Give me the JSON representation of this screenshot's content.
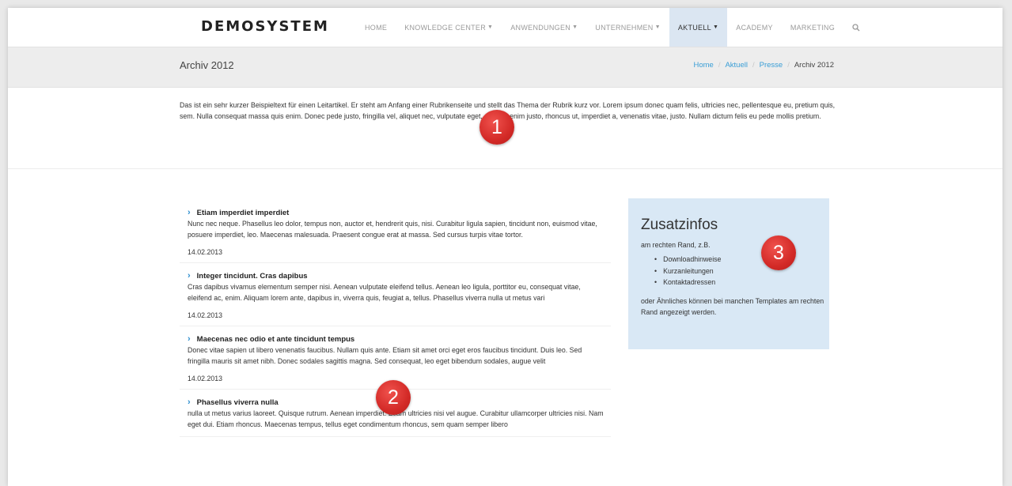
{
  "header": {
    "logo": "DEMOSYSTEM",
    "nav": [
      {
        "label": "HOME",
        "dropdown": false,
        "active": false
      },
      {
        "label": "KNOWLEDGE CENTER",
        "dropdown": true,
        "active": false
      },
      {
        "label": "ANWENDUNGEN",
        "dropdown": true,
        "active": false
      },
      {
        "label": "UNTERNEHMEN",
        "dropdown": true,
        "active": false
      },
      {
        "label": "AKTUELL",
        "dropdown": true,
        "active": true
      },
      {
        "label": "ACADEMY",
        "dropdown": false,
        "active": false
      },
      {
        "label": "MARKETING",
        "dropdown": false,
        "active": false
      }
    ],
    "search_icon": "search-icon"
  },
  "band": {
    "title": "Archiv 2012",
    "breadcrumb": [
      "Home",
      "Aktuell",
      "Presse",
      "Archiv 2012"
    ]
  },
  "intro": {
    "text": "Das ist ein sehr kurzer Beispieltext für einen Leitartikel. Er steht am Anfang einer Rubrikenseite und stellt das Thema der Rubrik kurz vor. Lorem ipsum donec quam felis, ultricies nec, pellentesque eu, pretium quis, sem. Nulla consequat massa quis enim. Donec pede justo, fringilla vel, aliquet nec, vulputate eget, arcu. In enim justo, rhoncus ut, imperdiet a, venenatis vitae, justo. Nullam dictum felis eu pede mollis pretium."
  },
  "articles": [
    {
      "title": "Etiam imperdiet imperdiet",
      "text": "Nunc nec neque. Phasellus leo dolor, tempus non, auctor et, hendrerit quis, nisi. Curabitur ligula sapien, tincidunt non, euismod vitae, posuere imperdiet, leo. Maecenas malesuada. Praesent congue erat at massa. Sed cursus turpis vitae tortor.",
      "date": "14.02.2013"
    },
    {
      "title": "Integer tincidunt. Cras dapibus",
      "text": "Cras dapibus vivamus elementum semper nisi. Aenean vulputate eleifend tellus. Aenean leo ligula, porttitor eu, consequat vitae, eleifend ac, enim. Aliquam lorem ante, dapibus in, viverra quis, feugiat a, tellus. Phasellus viverra nulla ut metus vari",
      "date": "14.02.2013"
    },
    {
      "title": "Maecenas nec odio et ante tincidunt tempus",
      "text": "Donec vitae sapien ut libero venenatis faucibus. Nullam quis ante. Etiam sit amet orci eget eros faucibus tincidunt. Duis leo. Sed fringilla mauris sit amet nibh. Donec sodales sagittis magna. Sed consequat, leo eget bibendum sodales, augue velit",
      "date": "14.02.2013"
    },
    {
      "title": "Phasellus viverra nulla",
      "text": "nulla ut metus varius laoreet. Quisque rutrum. Aenean imperdiet. Etiam ultricies nisi vel augue. Curabitur ullamcorper ultricies nisi. Nam eget dui. Etiam rhoncus. Maecenas tempus, tellus eget condimentum rhoncus, sem quam semper libero",
      "date": ""
    }
  ],
  "sidebar": {
    "title": "Zusatzinfos",
    "subtitle": "am rechten Rand, z.B.",
    "items": [
      "Downloadhinweise",
      "Kurzanleitungen",
      "Kontaktadressen"
    ],
    "footer": "oder Ähnliches können bei manchen Templates am rechten Rand angezeigt werden."
  },
  "markers": [
    "1",
    "2",
    "3"
  ],
  "colors": {
    "accent": "#3a9ed6",
    "active_nav_bg": "#dbe6f2",
    "sidebar_bg": "#d9e8f5",
    "marker": "#d32a27"
  }
}
